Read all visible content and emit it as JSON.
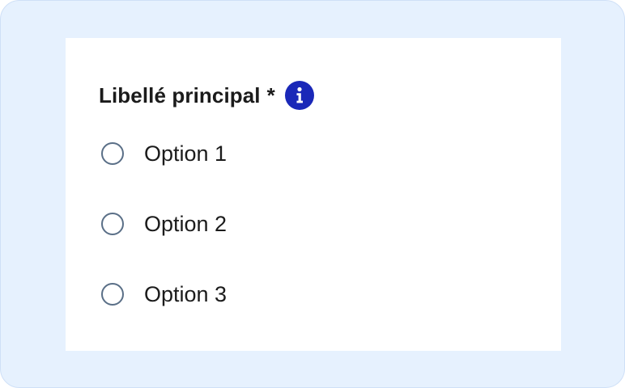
{
  "field": {
    "label": "Libellé principal",
    "required_mark": "*",
    "info_icon": "info-icon"
  },
  "options": [
    {
      "label": "Option 1",
      "selected": false
    },
    {
      "label": "Option 2",
      "selected": false
    },
    {
      "label": "Option 3",
      "selected": false
    }
  ],
  "colors": {
    "frame_background": "#e6f1fe",
    "card_background": "#ffffff",
    "info_accent": "#1a28b8",
    "radio_border": "#5a6f87",
    "text": "#1b1b1b"
  }
}
